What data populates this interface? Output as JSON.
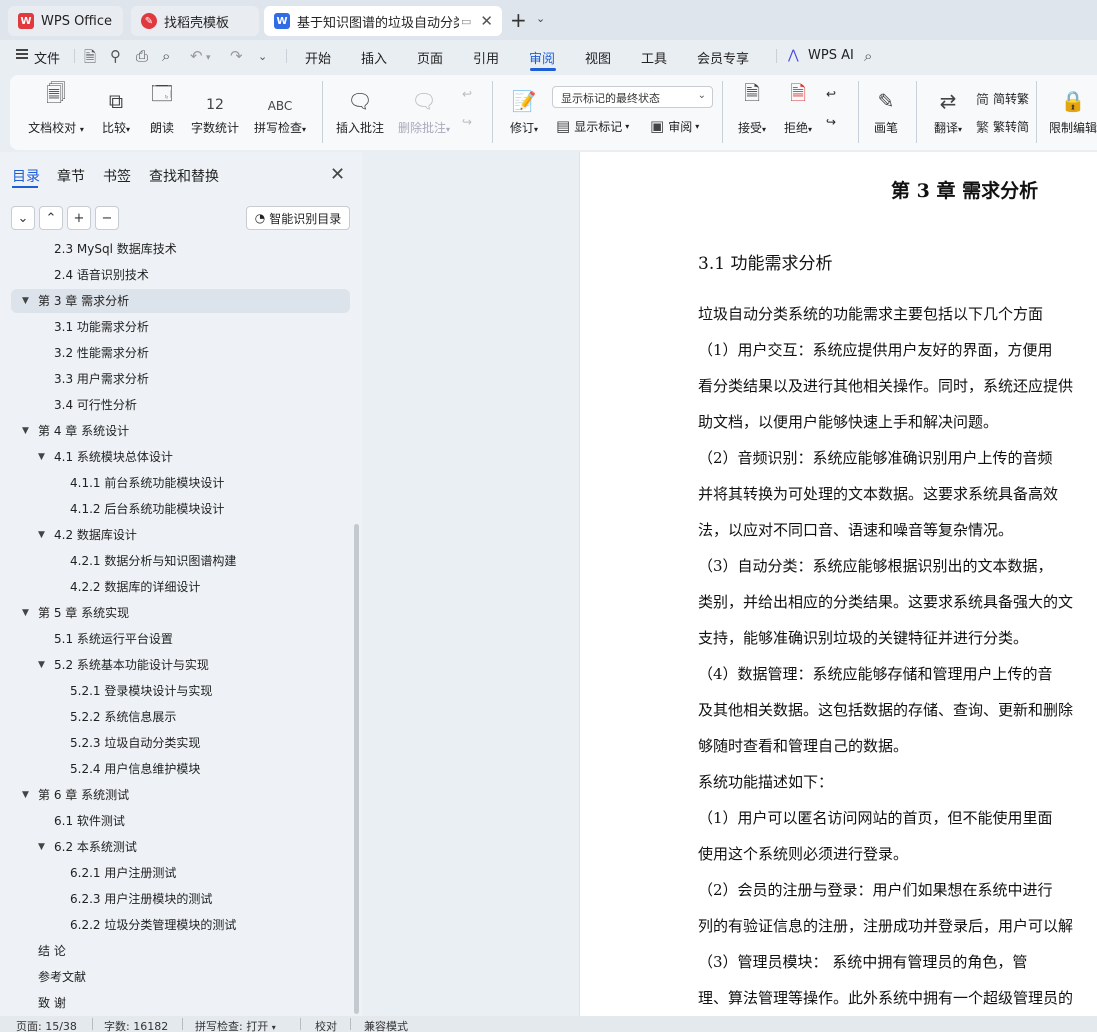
{
  "tabs": {
    "wps": "WPS Office",
    "daoke": "找稻壳模板",
    "doc": "基于知识图谱的垃圾自动分类系"
  },
  "menu": {
    "file": "文件",
    "items": [
      "开始",
      "插入",
      "页面",
      "引用",
      "审阅",
      "视图",
      "工具",
      "会员专享"
    ],
    "active": "审阅",
    "wps_ai": "WPS AI"
  },
  "ribbon": {
    "doc_check": "文档校对",
    "compare": "比较",
    "read_aloud": "朗读",
    "word_count": "字数统计",
    "spell_check": "拼写检查",
    "insert_comment": "插入批注",
    "delete_comment": "删除批注",
    "revise": "修订",
    "markup_state": "显示标记的最终状态",
    "show_markup": "显示标记",
    "review": "审阅",
    "accept": "接受",
    "reject": "拒绝",
    "pen": "画笔",
    "translate": "翻译",
    "to_traditional": "简转繁",
    "to_simplified": "繁转简",
    "restrict_edit": "限制编辑"
  },
  "nav": {
    "tabs": [
      "目录",
      "章节",
      "书签",
      "查找和替换"
    ],
    "smart_toc": "智能识别目录",
    "toc": [
      {
        "text": "2.3 MySql 数据库技术",
        "level": 1
      },
      {
        "text": "2.4  语音识别技术",
        "level": 1
      },
      {
        "text": "第 3 章    需求分析",
        "level": 0,
        "expanded": true,
        "selected": true
      },
      {
        "text": "3.1  功能需求分析",
        "level": 1
      },
      {
        "text": "3.2  性能需求分析",
        "level": 1
      },
      {
        "text": "3.3  用户需求分析",
        "level": 1
      },
      {
        "text": "3.4  可行性分析",
        "level": 1
      },
      {
        "text": "第 4 章  系统设计",
        "level": 0,
        "expanded": true
      },
      {
        "text": "4.1  系统模块总体设计",
        "level": 1,
        "expanded": true
      },
      {
        "text": "4.1.1  前台系统功能模块设计",
        "level": 2
      },
      {
        "text": "4.1.2  后台系统功能模块设计",
        "level": 2
      },
      {
        "text": "4.2  数据库设计",
        "level": 1,
        "expanded": true
      },
      {
        "text": "4.2.1  数据分析与知识图谱构建",
        "level": 2
      },
      {
        "text": "4.2.2  数据库的详细设计",
        "level": 2
      },
      {
        "text": "第 5 章  系统实现",
        "level": 0,
        "expanded": true
      },
      {
        "text": "5.1  系统运行平台设置",
        "level": 1
      },
      {
        "text": "5.2 系统基本功能设计与实现",
        "level": 1,
        "expanded": true
      },
      {
        "text": "5.2.1  登录模块设计与实现",
        "level": 2
      },
      {
        "text": "5.2.2  系统信息展示",
        "level": 2
      },
      {
        "text": "5.2.3  垃圾自动分类实现",
        "level": 2
      },
      {
        "text": "5.2.4  用户信息维护模块",
        "level": 2
      },
      {
        "text": "第 6 章  系统测试",
        "level": 0,
        "expanded": true
      },
      {
        "text": "6.1  软件测试",
        "level": 1
      },
      {
        "text": "6.2  本系统测试",
        "level": 1,
        "expanded": true
      },
      {
        "text": "6.2.1  用户注册测试",
        "level": 2
      },
      {
        "text": "6.2.3  用户注册模块的测试",
        "level": 2
      },
      {
        "text": "6.2.2  垃圾分类管理模块的测试",
        "level": 2
      },
      {
        "text": "结    论",
        "level": 0
      },
      {
        "text": "参考文献",
        "level": 0
      },
      {
        "text": "致    谢",
        "level": 0
      }
    ]
  },
  "document": {
    "chapter_title": "第 3 章    需求分析",
    "section_title": "3.1  功能需求分析",
    "lines": [
      "    垃圾自动分类系统的功能需求主要包括以下几个方面",
      "    （1）用户交互：系统应提供用户友好的界面，方便用",
      "看分类结果以及进行其他相关操作。同时，系统还应提供",
      "助文档，以便用户能够快速上手和解决问题。",
      "    （2）音频识别：系统应能够准确识别用户上传的音频",
      "并将其转换为可处理的文本数据。这要求系统具备高效",
      "法，以应对不同口音、语速和噪音等复杂情况。",
      "    （3）自动分类：系统应能够根据识别出的文本数据，",
      "类别，并给出相应的分类结果。这要求系统具备强大的文",
      "支持，能够准确识别垃圾的关键特征并进行分类。",
      "    （4）数据管理：系统应能够存储和管理用户上传的音",
      "及其他相关数据。这包括数据的存储、查询、更新和删除",
      "够随时查看和管理自己的数据。",
      "    系统功能描述如下：",
      "    （1）用户可以匿名访问网站的首页，但不能使用里面",
      "使用这个系统则必须进行登录。",
      "    （2）会员的注册与登录：用户们如果想在系统中进行",
      "列的有验证信息的注册，注册成功并登录后，用户可以解",
      "    （3）管理员模块：  系统中拥有管理员的角色，管",
      "理、算法管理等操作。此外系统中拥有一个超级管理员的"
    ]
  },
  "status": {
    "page": "页面: 15/38",
    "words": "字数: 16182",
    "spell": "拼写检查: 打开",
    "proof": "校对",
    "compat": "兼容模式"
  },
  "colors": {
    "accent": "#1f5fd6",
    "wps_red": "#e0393e",
    "word_blue": "#2f6ce5"
  }
}
